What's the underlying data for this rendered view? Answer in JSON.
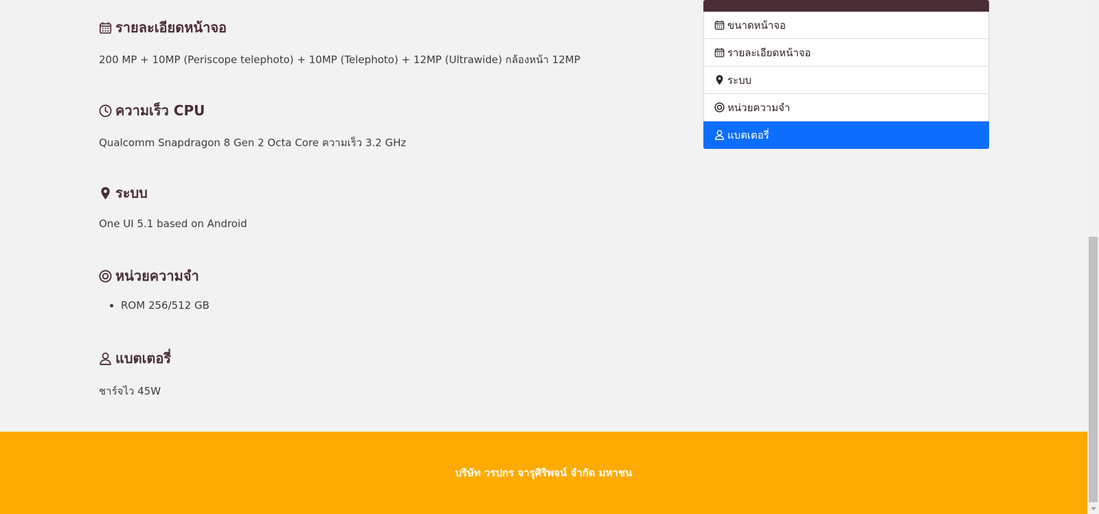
{
  "sections": [
    {
      "icon": "calendar-icon",
      "title": "รายละเอียดหน้าจอ",
      "text": "200 MP + 10MP (Periscope telephoto) + 10MP (Telephoto) + 12MP (Ultrawide) กล้องหน้า 12MP"
    },
    {
      "icon": "clock-icon",
      "title": "ความเร็ว CPU",
      "text": "Qualcomm Snapdragon 8 Gen 2 Octa Core ความเร็ว 3.2 GHz"
    },
    {
      "icon": "map-pin-icon",
      "title": "ระบบ",
      "text": "One UI 5.1 based on Android"
    },
    {
      "icon": "target-icon",
      "title": "หน่วยความจำ",
      "list": [
        "ROM 256/512 GB"
      ]
    },
    {
      "icon": "user-icon",
      "title": "แบตเตอรี่",
      "text": "ชาร์จไว 45W"
    }
  ],
  "sidebar": {
    "items": [
      {
        "icon": "calendar-icon",
        "label": "ขนาดหน้าจอ",
        "active": false
      },
      {
        "icon": "calendar-icon",
        "label": "รายละเอียดหน้าจอ",
        "active": false
      },
      {
        "icon": "map-pin-icon",
        "label": "ระบบ",
        "active": false
      },
      {
        "icon": "target-icon",
        "label": "หน่วยความจำ",
        "active": false
      },
      {
        "icon": "user-icon",
        "label": "แบตเตอรี่",
        "active": true
      }
    ]
  },
  "footer": {
    "text": "บริษัท วรปกร จารุศิริพจน์ จำกัด มหาชน"
  },
  "colors": {
    "heading": "#4a2e36",
    "active": "#0d6efd",
    "footer_bg": "#ffaa00"
  }
}
